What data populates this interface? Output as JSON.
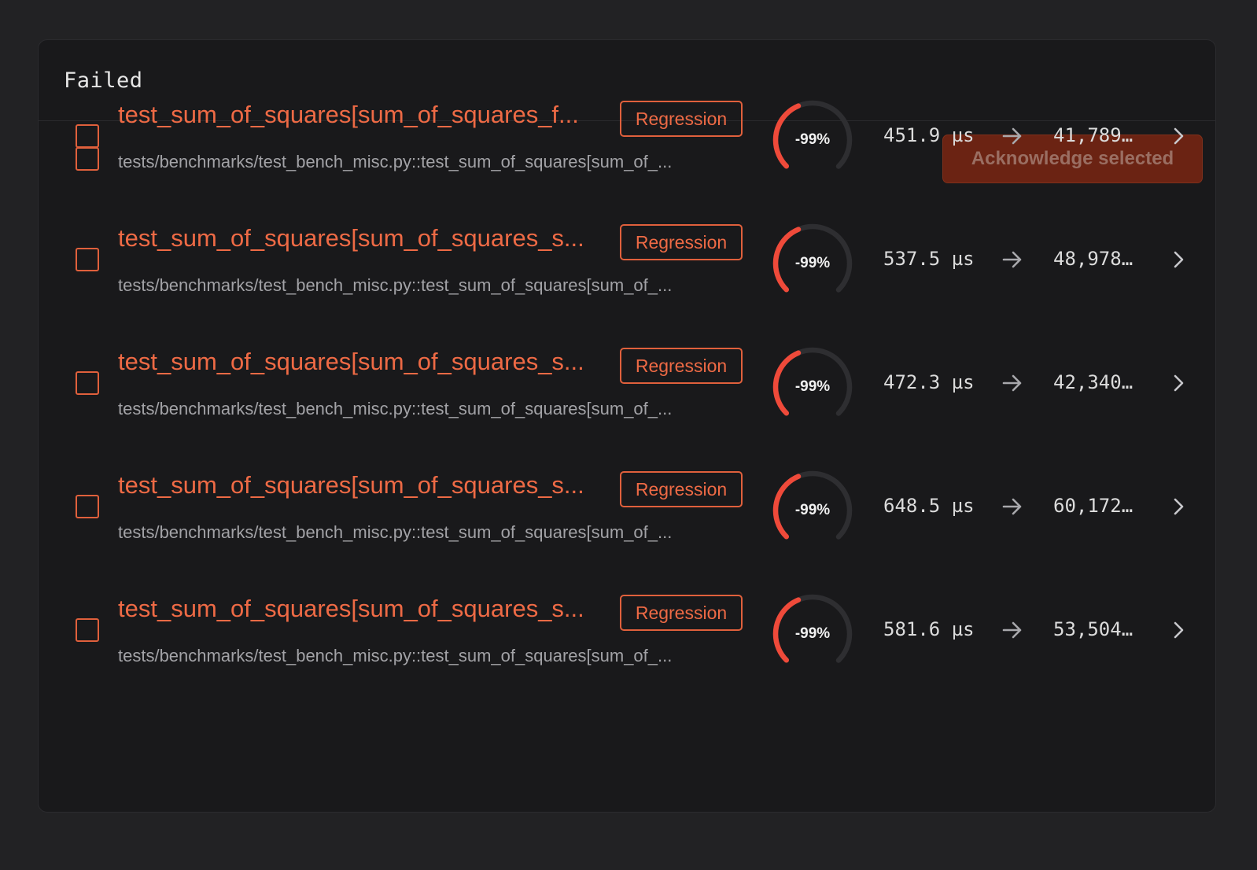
{
  "panel": {
    "title": "Failed",
    "acknowledge_label": "Acknowledge selected"
  },
  "colors": {
    "accent": "#ee6a45",
    "gauge_track": "#2e2e31",
    "gauge_fill_start": "#ef4a3a",
    "gauge_fill_end": "#f06a3c"
  },
  "rows": [
    {
      "name": "test_sum_of_squares[sum_of_squares_f...",
      "badge": "Regression",
      "path": "tests/benchmarks/test_bench_misc.py::test_sum_of_squares[sum_of_...",
      "change": "-99%",
      "change_fraction": 0.99,
      "from": "451.9 µs",
      "to": "41,789...."
    },
    {
      "name": "test_sum_of_squares[sum_of_squares_s...",
      "badge": "Regression",
      "path": "tests/benchmarks/test_bench_misc.py::test_sum_of_squares[sum_of_...",
      "change": "-99%",
      "change_fraction": 0.99,
      "from": "537.5 µs",
      "to": "48,978...."
    },
    {
      "name": "test_sum_of_squares[sum_of_squares_s...",
      "badge": "Regression",
      "path": "tests/benchmarks/test_bench_misc.py::test_sum_of_squares[sum_of_...",
      "change": "-99%",
      "change_fraction": 0.99,
      "from": "472.3 µs",
      "to": "42,340...."
    },
    {
      "name": "test_sum_of_squares[sum_of_squares_s...",
      "badge": "Regression",
      "path": "tests/benchmarks/test_bench_misc.py::test_sum_of_squares[sum_of_...",
      "change": "-99%",
      "change_fraction": 0.99,
      "from": "648.5 µs",
      "to": "60,172...."
    },
    {
      "name": "test_sum_of_squares[sum_of_squares_s...",
      "badge": "Regression",
      "path": "tests/benchmarks/test_bench_misc.py::test_sum_of_squares[sum_of_...",
      "change": "-99%",
      "change_fraction": 0.99,
      "from": "581.6 µs",
      "to": "53,504...."
    }
  ]
}
